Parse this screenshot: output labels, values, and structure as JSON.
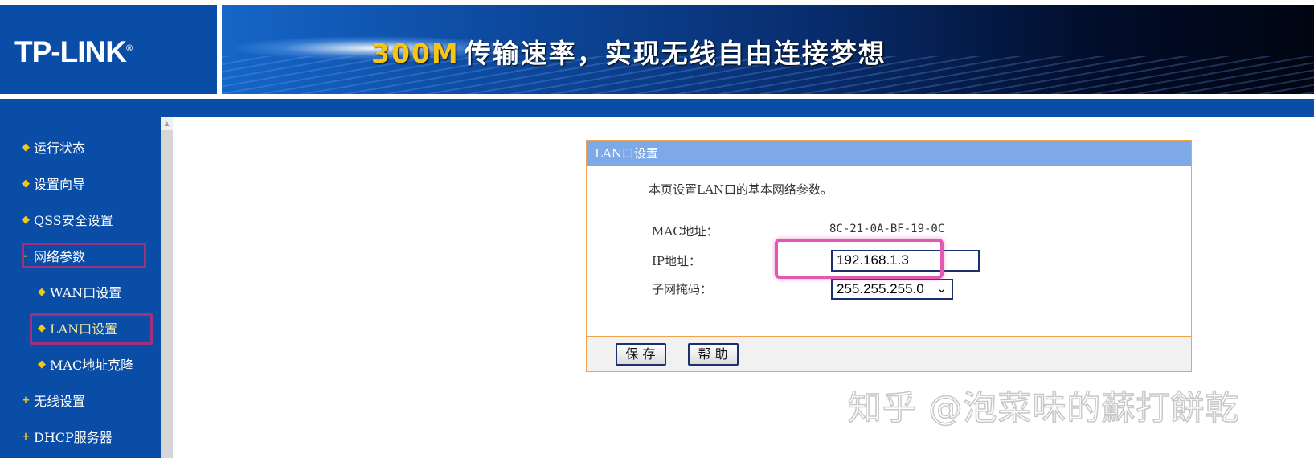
{
  "header": {
    "logo": "TP-LINK",
    "logo_mark": "®",
    "slogan_speed": "300M",
    "slogan_text": "传输速率，实现无线自由连接梦想"
  },
  "sidebar": {
    "items": [
      {
        "label": "运行状态",
        "icon": "bullet-icon"
      },
      {
        "label": "设置向导",
        "icon": "bullet-icon"
      },
      {
        "label": "QSS安全设置",
        "icon": "bullet-icon"
      },
      {
        "label": "网络参数",
        "icon": "minus-icon"
      },
      {
        "label": "WAN口设置",
        "icon": "bullet-icon"
      },
      {
        "label": "LAN口设置",
        "icon": "bullet-icon"
      },
      {
        "label": "MAC地址克隆",
        "icon": "bullet-icon"
      },
      {
        "label": "无线设置",
        "icon": "plus-icon"
      },
      {
        "label": "DHCP服务器",
        "icon": "plus-icon"
      }
    ]
  },
  "panel": {
    "title": "LAN口设置",
    "description": "本页设置LAN口的基本网络参数。",
    "mac_label": "MAC地址：",
    "mac_value": "8C-21-0A-BF-19-0C",
    "ip_label": "IP地址：",
    "ip_value": "192.168.1.3",
    "mask_label": "子网掩码：",
    "mask_value": "255.255.255.0",
    "save_label": "保存",
    "help_label": "帮助"
  },
  "watermark": "知乎 @泡菜味的蘇打餅乾",
  "colors": {
    "nav_blue": "#0a4da6",
    "panel_header": "#7ea9e8",
    "accent_yellow": "#f5c518",
    "highlight_pink": "#e05ab4",
    "highlight_purple": "#a0307e",
    "panel_border": "#f0a24c"
  }
}
